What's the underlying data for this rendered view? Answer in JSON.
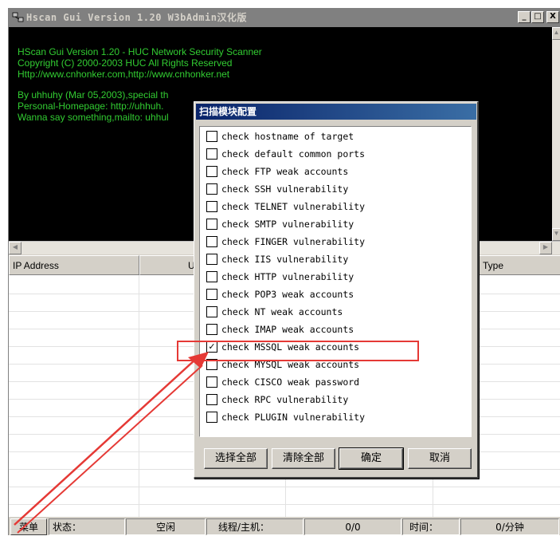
{
  "window": {
    "title": "Hscan Gui Version 1.20 W3bAdmin汉化版",
    "buttons": {
      "minimize": "_",
      "maximize": "□",
      "close": "X"
    }
  },
  "log": {
    "lines": [
      "HScan Gui Version 1.20 - HUC Network Security Scanner",
      "Copyright (C) 2000-2003 HUC All Rights Reserved",
      "Http://www.cnhonker.com,http://www.cnhonker.net",
      "",
      "By uhhuhy (Mar 05,2003),special th",
      "Personal-Homepage: http://uhhuh.",
      "Wanna say something,mailto: uhhul"
    ]
  },
  "table": {
    "columns": [
      "IP Address",
      "U",
      "",
      "Type"
    ]
  },
  "statusbar": {
    "menu": "菜单",
    "status_label": "状态：",
    "status_value": "空闲",
    "threads_label": "线程/主机：",
    "threads_value": "0/0",
    "time_label": "时间：",
    "time_value": "0/分钟"
  },
  "dialog": {
    "title": "扫描模块配置",
    "items": [
      {
        "label": "check hostname of target",
        "checked": false
      },
      {
        "label": "check default common ports",
        "checked": false
      },
      {
        "label": "check FTP weak accounts",
        "checked": false
      },
      {
        "label": "check SSH vulnerability",
        "checked": false
      },
      {
        "label": "check TELNET vulnerability",
        "checked": false
      },
      {
        "label": "check SMTP vulnerability",
        "checked": false
      },
      {
        "label": "check FINGER vulnerability",
        "checked": false
      },
      {
        "label": "check IIS vulnerability",
        "checked": false
      },
      {
        "label": "check HTTP vulnerability",
        "checked": false
      },
      {
        "label": "check POP3 weak accounts",
        "checked": false
      },
      {
        "label": "check NT weak accounts",
        "checked": false
      },
      {
        "label": "check IMAP weak accounts",
        "checked": false
      },
      {
        "label": "check MSSQL weak accounts",
        "checked": true
      },
      {
        "label": "check MYSQL weak accounts",
        "checked": false
      },
      {
        "label": "check CISCO weak password",
        "checked": false
      },
      {
        "label": "check RPC vulnerability",
        "checked": false
      },
      {
        "label": "check PLUGIN vulnerability",
        "checked": false
      }
    ],
    "buttons": {
      "select_all": "选择全部",
      "clear_all": "清除全部",
      "ok": "确定",
      "cancel": "取消"
    }
  },
  "annotation": {
    "color": "#e53935"
  }
}
